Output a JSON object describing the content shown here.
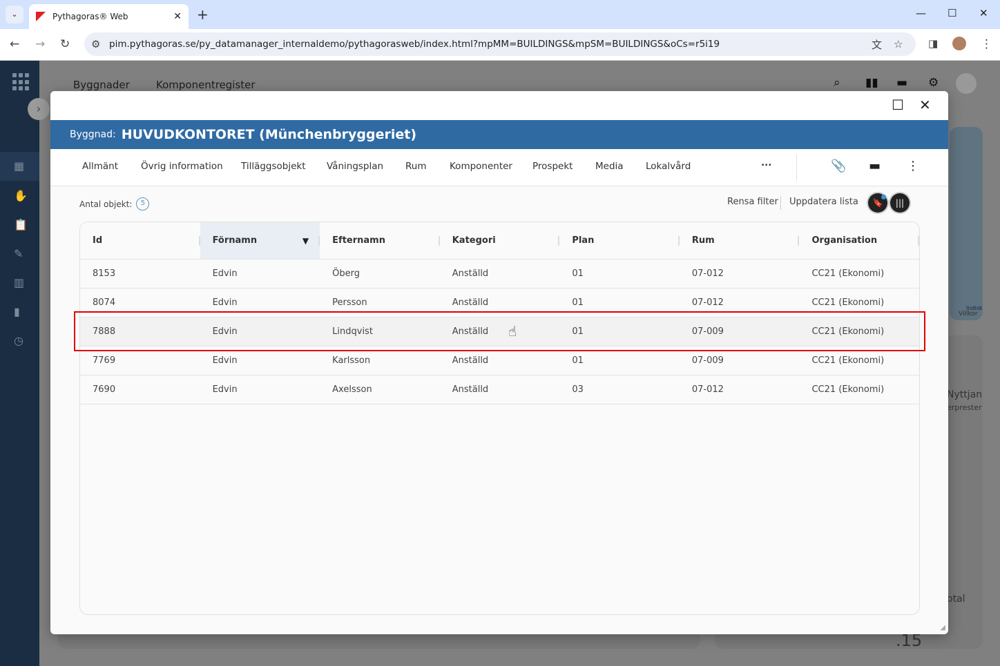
{
  "browser": {
    "tab_title": "Pythagoras® Web",
    "url": "pim.pythagoras.se/py_datamanager_internaldemo/pythagorasweb/index.html?mpMM=BUILDINGS&mpSM=BUILDINGS&oCs=r5i19"
  },
  "background": {
    "nav": [
      "Byggnader",
      "Komponentregister"
    ],
    "map_labels": [
      "Indisk",
      "Villkor"
    ],
    "panel_texts": [
      "Nyttjan",
      "erprester",
      "otal",
      ".15"
    ]
  },
  "modal": {
    "header_label": "Byggnad:",
    "header_title": "HUVUDKONTORET (Münchenbryggeriet)",
    "tabs": [
      "Allmänt",
      "Övrig information",
      "Tilläggsobjekt",
      "Våningsplan",
      "Rum",
      "Komponenter",
      "Prospekt",
      "Media",
      "Lokalvård"
    ],
    "more": "...",
    "count_label": "Antal objekt:",
    "count": "5",
    "clear_filter": "Rensa filter",
    "update_list": "Uppdatera lista",
    "columns": [
      "Id",
      "Förnamn",
      "Efternamn",
      "Kategori",
      "Plan",
      "Rum",
      "Organisation"
    ],
    "rows": [
      [
        "8153",
        "Edvin",
        "Öberg",
        "Anställd",
        "01",
        "07-012",
        "CC21 (Ekonomi)"
      ],
      [
        "8074",
        "Edvin",
        "Persson",
        "Anställd",
        "01",
        "07-012",
        "CC21 (Ekonomi)"
      ],
      [
        "7888",
        "Edvin",
        "Lindqvist",
        "Anställd",
        "01",
        "07-009",
        "CC21 (Ekonomi)"
      ],
      [
        "7769",
        "Edvin",
        "Karlsson",
        "Anställd",
        "01",
        "07-009",
        "CC21 (Ekonomi)"
      ],
      [
        "7690",
        "Edvin",
        "Axelsson",
        "Anställd",
        "03",
        "07-012",
        "CC21 (Ekonomi)"
      ]
    ],
    "selected_row": 2
  },
  "colors": {
    "header_blue": "#2f6aa3",
    "highlight": "#e00000",
    "sidebar": "#1a2d43"
  }
}
